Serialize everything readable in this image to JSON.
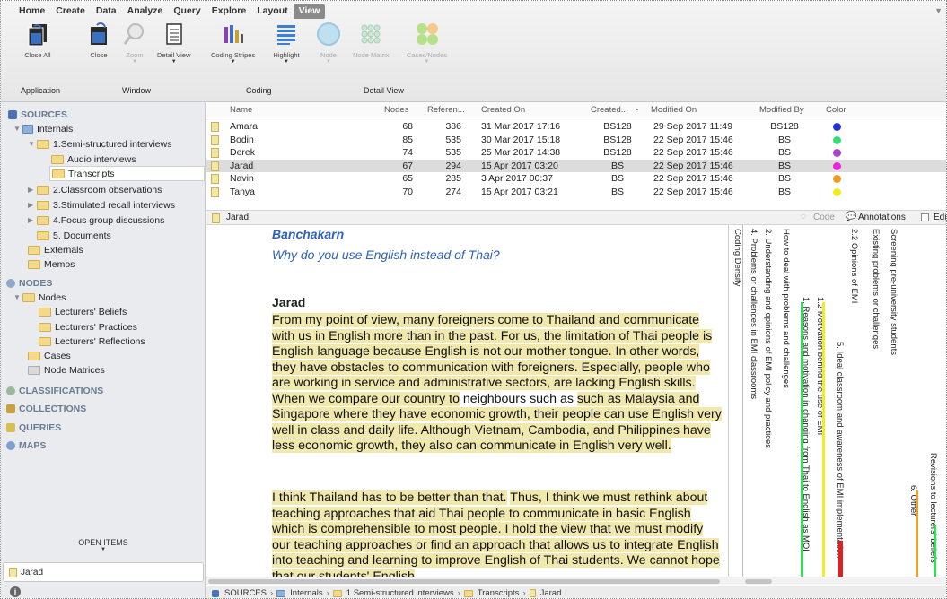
{
  "menu": [
    "Home",
    "Create",
    "Data",
    "Analyze",
    "Query",
    "Explore",
    "Layout",
    "View"
  ],
  "ribbon": {
    "buttons": [
      {
        "label": "Close All",
        "icon": "close-all-icon"
      },
      {
        "label": "Close",
        "icon": "close-window-icon"
      },
      {
        "label": "Zoom",
        "icon": "zoom-icon"
      },
      {
        "label": "Detail View",
        "icon": "detail-view-icon"
      },
      {
        "label": "Coding Stripes",
        "icon": "coding-stripes-icon"
      },
      {
        "label": "Highlight",
        "icon": "highlight-icon"
      },
      {
        "label": "Node",
        "icon": "node-icon"
      },
      {
        "label": "Node Matrix",
        "icon": "node-matrix-icon"
      },
      {
        "label": "Cases/Nodes",
        "icon": "cases-nodes-icon"
      }
    ],
    "groups": [
      "Application",
      "Window",
      "Coding",
      "Detail View"
    ]
  },
  "nav": {
    "sources": "SOURCES",
    "internals": "Internals",
    "folder1": "1.Semi-structured interviews",
    "audio": "Audio interviews",
    "transcripts": "Transcripts",
    "folder2": "2.Classroom observations",
    "folder3": "3.Stimulated recall interviews",
    "folder4": "4.Focus group discussions",
    "folder5": "5. Documents",
    "externals": "Externals",
    "memos": "Memos",
    "nodes_head": "NODES",
    "nodes": "Nodes",
    "beliefs": "Lecturers' Beliefs",
    "practices": "Lecturers' Practices",
    "reflections": "Lecturers' Reflections",
    "cases": "Cases",
    "matrices": "Node Matrices",
    "classifications": "CLASSIFICATIONS",
    "collections": "COLLECTIONS",
    "queries": "QUERIES",
    "maps": "MAPS",
    "open_items": "OPEN ITEMS",
    "open_item": "Jarad"
  },
  "list": {
    "headers": {
      "name": "Name",
      "nodes": "Nodes",
      "references": "Referen...",
      "created_on": "Created On",
      "created_by": "Created...",
      "modified_on": "Modified On",
      "modified_by": "Modified By",
      "color": "Color"
    },
    "rows": [
      {
        "name": "Amara",
        "nodes": "68",
        "refs": "386",
        "created": "31 Mar 2017 17:16",
        "created_by": "BS128",
        "modified": "29 Sep 2017 11:49",
        "modified_by": "BS128",
        "color": "#2233dd"
      },
      {
        "name": "Bodin",
        "nodes": "85",
        "refs": "535",
        "created": "30 Mar 2017 15:18",
        "created_by": "BS128",
        "modified": "22 Sep 2017 15:46",
        "modified_by": "BS",
        "color": "#33dd77"
      },
      {
        "name": "Derek",
        "nodes": "74",
        "refs": "535",
        "created": "25 Mar 2017 14:38",
        "created_by": "BS128",
        "modified": "22 Sep 2017 15:46",
        "modified_by": "BS",
        "color": "#aa44cc"
      },
      {
        "name": "Jarad",
        "nodes": "67",
        "refs": "294",
        "created": "15 Apr 2017 03:20",
        "created_by": "BS",
        "modified": "22 Sep 2017 15:46",
        "modified_by": "BS",
        "color": "#ee22dd"
      },
      {
        "name": "Navin",
        "nodes": "65",
        "refs": "285",
        "created": "3 Apr 2017 00:37",
        "created_by": "BS",
        "modified": "22 Sep 2017 15:46",
        "modified_by": "BS",
        "color": "#f09a20"
      },
      {
        "name": "Tanya",
        "nodes": "70",
        "refs": "274",
        "created": "15 Apr 2017 03:21",
        "created_by": "BS",
        "modified": "22 Sep 2017 15:46",
        "modified_by": "BS",
        "color": "#f0ee20"
      }
    ]
  },
  "detail": {
    "title": "Jarad",
    "code": "Code",
    "annotations": "Annotations",
    "edit": "Edi"
  },
  "document": {
    "speaker1": "Banchakarn",
    "question": "Why do you use English instead of Thai?",
    "speaker2": "Jarad",
    "p1_hl1": "From my point of view, many foreigners come to Thailand and communicate with us in English more than in the past. For us, the limitation of Thai people is English language because English is not our mother tongue. In other words, they have obstacles to communication with foreigners. Especially, people who are working in service and administrative sectors, are lacking English skills.",
    "p1_hl2": "When we compare our country to",
    "p1_plain": "neighbours such as",
    "p1_hl3": "such as Malaysia and Singapore where they have economic growth, their people can use English very well in class and daily life. Although Vietnam, Cambodia, and Philippines have less economic growth, they also can communicate in English very well.",
    "p2_hl1": "I think Thailand has to be better than that.",
    "p2_hl2": "Thus, I think we must rethink about teaching approaches that aid Thai people to communicate in basic English which is comprehensible to most people. I hold the view that we must modify our teaching approaches or find an approach that allows us to integrate English into teaching and learning to improve English of Thai students. We cannot hope that our students' English"
  },
  "stripes": {
    "labels": [
      "Coding Density",
      "4. Problems or challenges in EMI classrooms",
      "2. Understanding and opinions of EMI policy and practices",
      "How to deal with problems and challenges",
      "1. Reasons and motivation in changing from Thai to English as MOI",
      "1.2 Motivation behind the use of EMI",
      "5. Ideal classroom and awareness of EMI implementation",
      "2.2 Opinions of EMI",
      "Existing problems or challenges",
      "Screening pre-university students",
      "6. Other",
      "Revisions to lecturers' beliefs"
    ],
    "bar_colors": [
      "#33dd55",
      "#f0ee20",
      "#dd2222",
      "#f0a030",
      "#33dd55"
    ]
  },
  "breadcrumb": [
    "SOURCES",
    "Internals",
    "1.Semi-structured interviews",
    "Transcripts",
    "Jarad"
  ]
}
